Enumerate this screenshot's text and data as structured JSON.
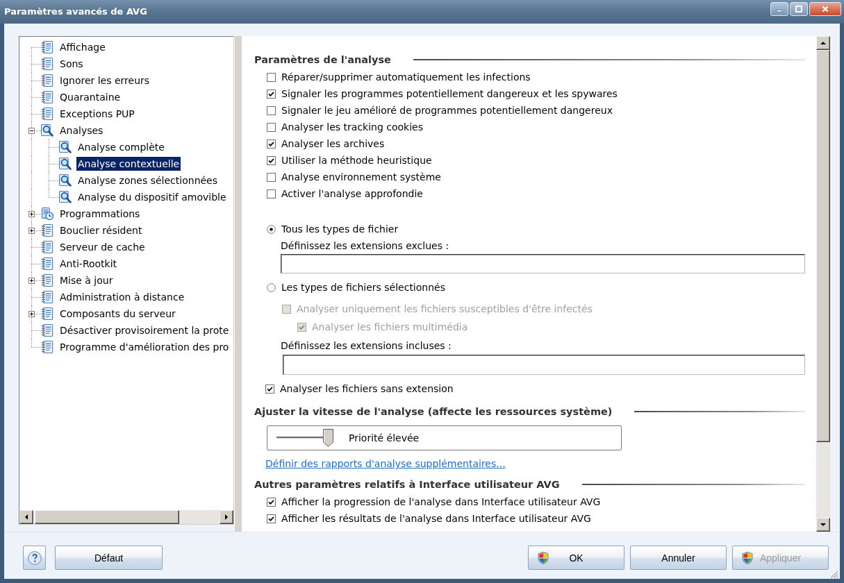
{
  "window": {
    "title": "Paramètres avancés de AVG"
  },
  "tree": {
    "items": [
      {
        "label": "Affichage",
        "kind": "page",
        "selected": false
      },
      {
        "label": "Sons",
        "kind": "page",
        "selected": false
      },
      {
        "label": "Ignorer les erreurs",
        "kind": "page",
        "selected": false
      },
      {
        "label": "Quarantaine",
        "kind": "page",
        "selected": false
      },
      {
        "label": "Exceptions PUP",
        "kind": "page",
        "selected": false
      },
      {
        "label": "Analyses",
        "kind": "scan",
        "selected": false,
        "expanded": true,
        "children": [
          {
            "label": "Analyse complète",
            "kind": "scan",
            "selected": false
          },
          {
            "label": "Analyse contextuelle",
            "kind": "scan",
            "selected": true
          },
          {
            "label": "Analyse zones sélectionnées",
            "kind": "scan",
            "selected": false
          },
          {
            "label": "Analyse du dispositif amovible",
            "kind": "scan",
            "selected": false
          }
        ]
      },
      {
        "label": "Programmations",
        "kind": "schedule",
        "selected": false,
        "expanded": false
      },
      {
        "label": "Bouclier résident",
        "kind": "page",
        "selected": false,
        "expanded": false
      },
      {
        "label": "Serveur de cache",
        "kind": "page",
        "selected": false
      },
      {
        "label": "Anti-Rootkit",
        "kind": "page",
        "selected": false
      },
      {
        "label": "Mise à jour",
        "kind": "page",
        "selected": false,
        "expanded": false
      },
      {
        "label": "Administration à distance",
        "kind": "page",
        "selected": false
      },
      {
        "label": "Composants du serveur",
        "kind": "page",
        "selected": false,
        "expanded": false
      },
      {
        "label": "Désactiver provisoirement la prote",
        "kind": "page",
        "selected": false
      },
      {
        "label": "Programme d'amélioration des pro",
        "kind": "page",
        "selected": false
      }
    ]
  },
  "scan_settings": {
    "heading": "Paramètres de l'analyse",
    "options": [
      {
        "label": "Réparer/supprimer automatiquement les infections",
        "checked": false
      },
      {
        "label": "Signaler les programmes potentiellement dangereux et les spywares",
        "checked": true
      },
      {
        "label": "Signaler le jeu amélioré de programmes potentiellement dangereux",
        "checked": false
      },
      {
        "label": "Analyser les tracking cookies",
        "checked": false
      },
      {
        "label": "Analyser les archives",
        "checked": true
      },
      {
        "label": "Utiliser la méthode heuristique",
        "checked": true
      },
      {
        "label": "Analyse environnement système",
        "checked": false
      },
      {
        "label": "Activer l'analyse approfondie",
        "checked": false
      }
    ]
  },
  "file_types": [
    {
      "label": "Tous les types de fichier",
      "selected": true,
      "extensions_label": "Définissez les extensions exclues :"
    },
    {
      "label": "Les types de fichiers sélectionnés",
      "selected": false,
      "options": [
        {
          "label": "Analyser uniquement les fichiers susceptibles d'être infectés",
          "checked": false,
          "disabled": true,
          "children": [
            {
              "label": "Analyser les fichiers multimédia",
              "checked": true,
              "disabled": true
            }
          ]
        }
      ],
      "extensions_label": "Définissez les extensions incluses :"
    }
  ],
  "no_extension": {
    "label": "Analyser les fichiers sans extension",
    "checked": true
  },
  "speed": {
    "heading": "Ajuster la vitesse de l'analyse (affecte les ressources système)",
    "slider": {
      "level": 1,
      "reading": "Priorité élevée"
    }
  },
  "report_link": "Définir des rapports d'analyse supplémentaires...",
  "ui_settings": {
    "heading": "Autres paramètres relatifs à Interface utilisateur AVG",
    "options": [
      {
        "label": "Afficher la progression de l'analyse dans Interface utilisateur AVG",
        "checked": true
      },
      {
        "label": "Afficher les résultats de l'analyse dans Interface utilisateur AVG",
        "checked": true
      }
    ]
  },
  "buttons": {
    "left": [
      {
        "label": "Défaut",
        "kind": "plain",
        "disabled": false
      }
    ],
    "right": [
      {
        "label": "OK",
        "kind": "shield",
        "disabled": false
      },
      {
        "label": "Annuler",
        "kind": "plain",
        "disabled": false
      },
      {
        "label": "Appliquer",
        "kind": "shield",
        "disabled": true
      }
    ]
  }
}
